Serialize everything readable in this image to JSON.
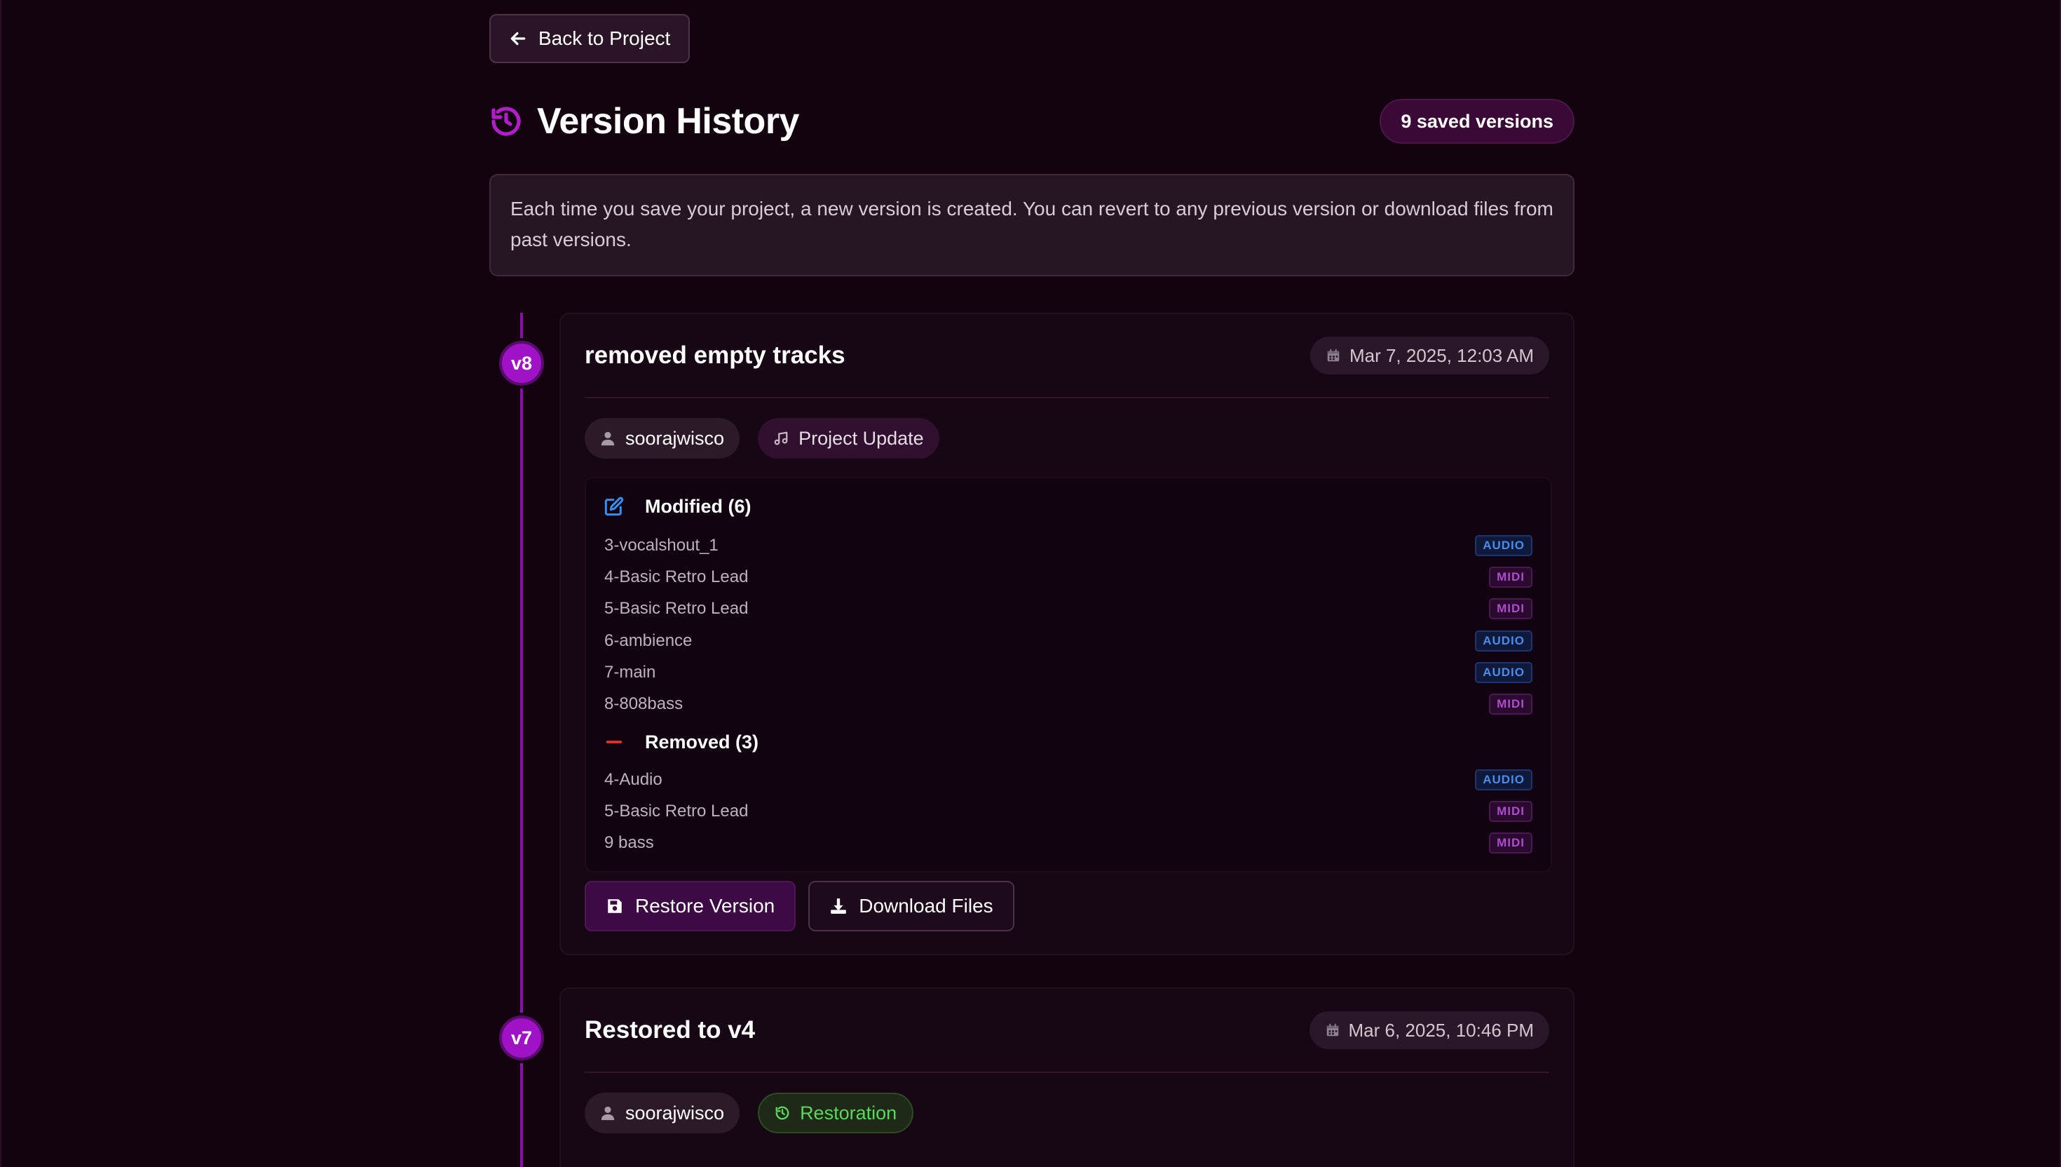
{
  "nav": {
    "back_label": "Back to Project"
  },
  "header": {
    "title": "Version History",
    "count_label": "9 saved versions"
  },
  "info": {
    "text": "Each time you save your project, a new version is created. You can revert to any previous version or download files from past versions."
  },
  "versions": [
    {
      "badge": "v8",
      "title": "removed empty tracks",
      "date": "Mar 7, 2025, 12:03 AM",
      "user": "soorajwisco",
      "type_label": "Project Update",
      "modified_label": "Modified (6)",
      "modified": [
        {
          "name": "3-vocalshout_1",
          "type": "AUDIO"
        },
        {
          "name": "4-Basic Retro Lead",
          "type": "MIDI"
        },
        {
          "name": "5-Basic Retro Lead",
          "type": "MIDI"
        },
        {
          "name": "6-ambience",
          "type": "AUDIO"
        },
        {
          "name": "7-main",
          "type": "AUDIO"
        },
        {
          "name": "8-808bass",
          "type": "MIDI"
        }
      ],
      "removed_label": "Removed (3)",
      "removed": [
        {
          "name": "4-Audio",
          "type": "AUDIO"
        },
        {
          "name": "5-Basic Retro Lead",
          "type": "MIDI"
        },
        {
          "name": "9 bass",
          "type": "MIDI"
        }
      ],
      "restore_label": "Restore Version",
      "download_label": "Download Files"
    },
    {
      "badge": "v7",
      "title": "Restored to v4",
      "date": "Mar 6, 2025, 10:46 PM",
      "user": "soorajwisco",
      "type_label": "Restoration"
    }
  ],
  "colors": {
    "background": "#12030f",
    "accent": "#a012c6",
    "audio": "#4a8cf0",
    "midi": "#b04ad0",
    "removed": "#e0342c",
    "restoration": "#5cd65c"
  },
  "icons": {
    "back": "arrow-left-icon",
    "history": "history-icon",
    "calendar": "calendar-icon",
    "user": "user-icon",
    "music": "music-note-icon",
    "edit": "edit-icon",
    "minus": "minus-icon",
    "save": "save-icon",
    "download": "download-icon",
    "restore": "restore-icon"
  }
}
